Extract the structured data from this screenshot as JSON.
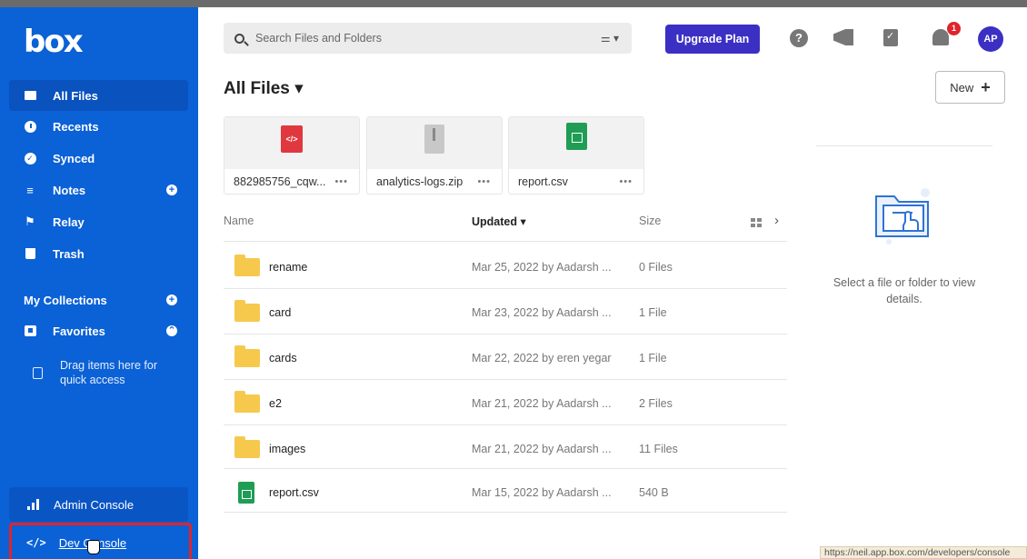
{
  "app": {
    "logo": "box"
  },
  "sidebar": {
    "items": [
      {
        "label": "All Files"
      },
      {
        "label": "Recents"
      },
      {
        "label": "Synced"
      },
      {
        "label": "Notes"
      },
      {
        "label": "Relay"
      },
      {
        "label": "Trash"
      }
    ],
    "collections_label": "My Collections",
    "favorites_label": "Favorites",
    "drag_hint": "Drag items here for quick access",
    "admin_console": "Admin Console",
    "dev_console": "Dev Console"
  },
  "header": {
    "search_placeholder": "Search Files and Folders",
    "upgrade_label": "Upgrade Plan",
    "notification_count": "1",
    "avatar_initials": "AP"
  },
  "main": {
    "title": "All Files",
    "new_label": "New",
    "recent_files": [
      {
        "name": "882985756_cqw...",
        "type": "html"
      },
      {
        "name": "analytics-logs.zip",
        "type": "zip"
      },
      {
        "name": "report.csv",
        "type": "csv"
      }
    ],
    "columns": {
      "name": "Name",
      "updated": "Updated",
      "size": "Size"
    },
    "rows": [
      {
        "name": "rename",
        "updated": "Mar 25, 2022 by Aadarsh ...",
        "size": "0 Files",
        "type": "folder"
      },
      {
        "name": "card",
        "updated": "Mar 23, 2022 by Aadarsh ...",
        "size": "1 File",
        "type": "folder"
      },
      {
        "name": "cards",
        "updated": "Mar 22, 2022 by eren yegar",
        "size": "1 File",
        "type": "folder"
      },
      {
        "name": "e2",
        "updated": "Mar 21, 2022 by Aadarsh ...",
        "size": "2 Files",
        "type": "folder"
      },
      {
        "name": "images",
        "updated": "Mar 21, 2022 by Aadarsh ...",
        "size": "11 Files",
        "type": "folder"
      },
      {
        "name": "report.csv",
        "updated": "Mar 15, 2022 by Aadarsh ...",
        "size": "540 B",
        "type": "csv"
      }
    ]
  },
  "details": {
    "empty_text": "Select a file or folder to view details."
  },
  "status": {
    "url": "https://neil.app.box.com/developers/console"
  },
  "colors": {
    "brand": "#0b61d6",
    "upgrade": "#3b2fc4",
    "highlight": "#e0242b"
  }
}
